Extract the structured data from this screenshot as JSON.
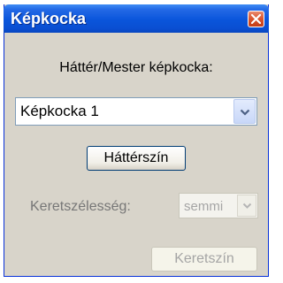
{
  "window": {
    "title": "Képkocka"
  },
  "frame_section": {
    "label": "Háttér/Mester képkocka:",
    "selected": "Képkocka 1"
  },
  "buttons": {
    "background_color": "Háttérszín",
    "border_color": "Keretszín"
  },
  "border_width": {
    "label": "Keretszélesség:",
    "selected": "semmi"
  },
  "colors": {
    "title_bar": "#0a55db",
    "window_bg": "#d8d4ca",
    "close_button": "#d9532c",
    "disabled_text": "#a5a5a5"
  },
  "icons": {
    "close": "close-icon",
    "dropdown": "chevron-down-icon"
  }
}
